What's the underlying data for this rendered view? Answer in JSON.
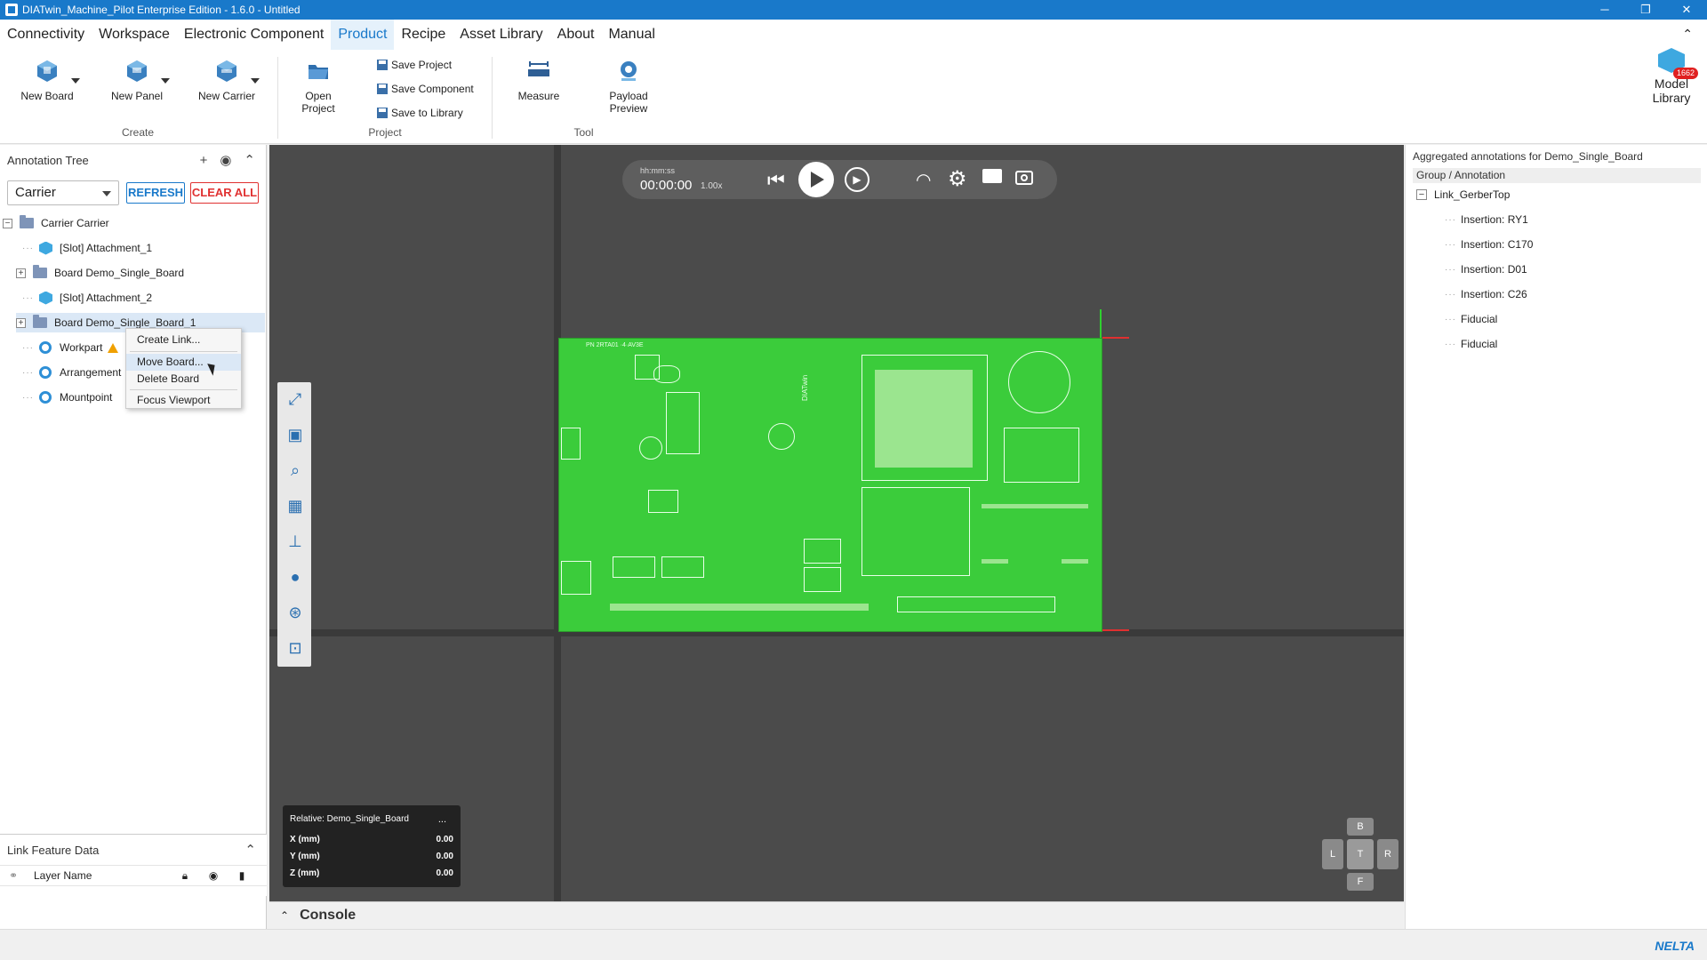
{
  "window": {
    "title": "DIATwin_Machine_Pilot Enterprise Edition - 1.6.0 - Untitled",
    "minimize": "─",
    "restore": "❐",
    "close": "✕"
  },
  "menu": {
    "items": [
      "Connectivity",
      "Workspace",
      "Electronic Component",
      "Product",
      "Recipe",
      "Asset Library",
      "About",
      "Manual"
    ],
    "active": "Product",
    "collapse": "⌃"
  },
  "ribbon": {
    "create": {
      "label": "Create",
      "new_board": "New Board",
      "new_panel": "New Panel",
      "new_carrier": "New Carrier"
    },
    "project": {
      "label": "Project",
      "open_project": "Open Project",
      "save_project": "Save Project",
      "save_component": "Save Component",
      "save_to_library": "Save to Library"
    },
    "tool": {
      "label": "Tool",
      "measure": "Measure",
      "payload_preview": "Payload Preview"
    },
    "model_library": {
      "label": "Model Library",
      "badge": "1662"
    }
  },
  "annotation_tree": {
    "title": "Annotation Tree",
    "filter_value": "Carrier",
    "refresh_label": "REFRESH",
    "clear_all_label": "CLEAR ALL",
    "nodes": [
      {
        "label": "Carrier  Carrier"
      },
      {
        "label": "[Slot] Attachment_1"
      },
      {
        "label": "Board  Demo_Single_Board"
      },
      {
        "label": "[Slot] Attachment_2"
      },
      {
        "label": "Board  Demo_Single_Board_1"
      },
      {
        "label": "Workpart"
      },
      {
        "label": "Arrangement"
      },
      {
        "label": "Mountpoint"
      }
    ]
  },
  "context_menu": {
    "items": [
      "Create Link...",
      "Move Board...",
      "Delete Board",
      "Focus Viewport"
    ],
    "hovered": "Move Board..."
  },
  "link_feature_data": {
    "title": "Link Feature Data",
    "layer_name_label": "Layer Name"
  },
  "viewport": {
    "time_format": "hh:mm:ss",
    "time": "00:00:00",
    "speed": "1.00x",
    "coords": {
      "relative": "Relative: Demo_Single_Board",
      "more": "...",
      "x_label": "X (mm)",
      "x_value": "0.00",
      "y_label": "Y (mm)",
      "y_value": "0.00",
      "z_label": "Z (mm)",
      "z_value": "0.00"
    },
    "navcube": {
      "top": "B",
      "left": "L",
      "center": "T",
      "right": "R",
      "bottom": "F"
    },
    "board_text": "PN 2RTA01 ·4·AV3E",
    "board_logo": "DIATwin"
  },
  "console": {
    "label": "Console",
    "chevron": "⌃"
  },
  "aggregated": {
    "header": "Aggregated annotations for Demo_Single_Board",
    "column": "Group / Annotation",
    "group": "Link_GerberTop",
    "items": [
      "Insertion: RY1",
      "Insertion: C170",
      "Insertion: D01",
      "Insertion: C26",
      "Fiducial",
      "Fiducial"
    ]
  },
  "status": {
    "brand": "NELTA"
  },
  "colors": {
    "accent": "#1979ca",
    "board_green": "#3bcc3b",
    "clear_all_red": "#e03030"
  }
}
